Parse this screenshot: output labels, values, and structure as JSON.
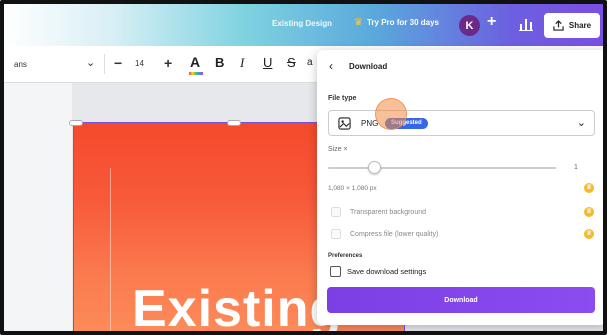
{
  "header": {
    "design_title": "Existing Design",
    "try_pro": "Try Pro for 30 days",
    "avatar_letter": "K",
    "share_label": "Share"
  },
  "toolbar": {
    "font_name": "ans",
    "font_size": "14",
    "minus": "−",
    "plus": "+",
    "color_letter": "A",
    "bold": "B",
    "italic": "I",
    "underline": "U",
    "strike": "S",
    "more": "a"
  },
  "canvas": {
    "text": "Existing"
  },
  "download_panel": {
    "title": "Download",
    "file_type_label": "File type",
    "file_type_value": "PNG",
    "suggested_badge": "Suggested",
    "size_label": "Size ×",
    "size_value": "1",
    "dimensions": "1,080 × 1,080 px",
    "options": [
      {
        "label": "Transparent background",
        "pro": true
      },
      {
        "label": "Compress file (lower quality)",
        "pro": true
      }
    ],
    "preferences_label": "Preferences",
    "save_settings_label": "Save download settings",
    "download_button": "Download"
  },
  "colors": {
    "accent": "#7b3fe4",
    "badge": "#3567e6",
    "pro": "#f5b92a",
    "design_top": "#f44a2c",
    "design_bottom": "#fd8e5a"
  },
  "icons": [
    "crown-icon",
    "plus-icon",
    "chart-icon",
    "share-icon",
    "chevron-down-icon",
    "back-arrow-icon",
    "image-icon",
    "pro-crown-icon"
  ]
}
